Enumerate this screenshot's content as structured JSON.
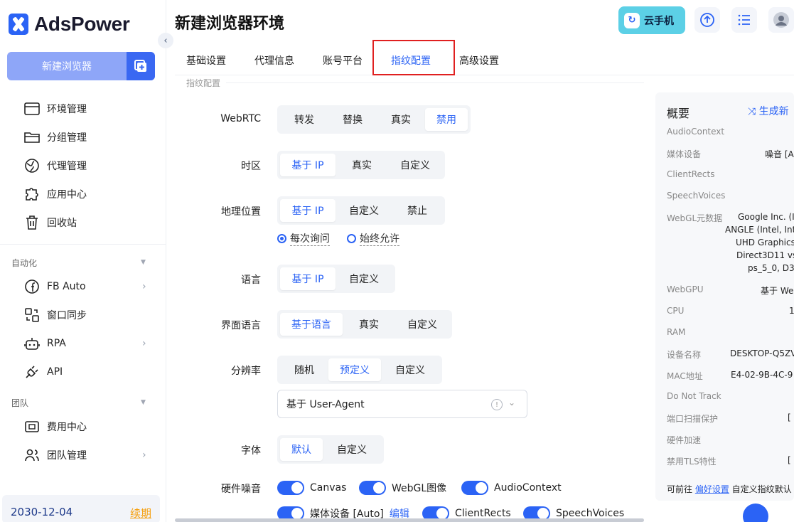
{
  "app": {
    "logo_text": "AdsPower",
    "brand_color": "#2b63f5"
  },
  "sidebar": {
    "new_browser_label": "新建浏览器",
    "items": [
      {
        "label": "环境管理",
        "icon": "browser-window-icon"
      },
      {
        "label": "分组管理",
        "icon": "folder-icon"
      },
      {
        "label": "代理管理",
        "icon": "globe-icon"
      },
      {
        "label": "应用中心",
        "icon": "puzzle-icon"
      },
      {
        "label": "回收站",
        "icon": "trash-icon"
      }
    ],
    "automation_title": "自动化",
    "automation_items": [
      {
        "label": "FB Auto",
        "icon": "facebook-icon"
      },
      {
        "label": "窗口同步",
        "icon": "sync-windows-icon"
      },
      {
        "label": "RPA",
        "icon": "robot-icon"
      },
      {
        "label": "API",
        "icon": "plug-icon"
      }
    ],
    "team_title": "团队",
    "team_items": [
      {
        "label": "费用中心",
        "icon": "wallet-icon"
      },
      {
        "label": "团队管理",
        "icon": "users-icon"
      }
    ],
    "expire_date": "2030-12-04",
    "renew_label": "续期"
  },
  "header": {
    "title": "新建浏览器环境",
    "cloud_phone_label": "云手机"
  },
  "tabs": [
    "基础设置",
    "代理信息",
    "账号平台",
    "指纹配置",
    "高级设置"
  ],
  "active_tab": "指纹配置",
  "section_label": "指纹配置",
  "form": {
    "webrtc": {
      "label": "WebRTC",
      "options": [
        "转发",
        "替换",
        "真实",
        "禁用"
      ],
      "selected": "禁用"
    },
    "timezone": {
      "label": "时区",
      "options": [
        "基于 IP",
        "真实",
        "自定义"
      ],
      "selected": "基于 IP"
    },
    "geo": {
      "label": "地理位置",
      "options": [
        "基于 IP",
        "自定义",
        "禁止"
      ],
      "selected": "基于 IP",
      "radio": [
        "每次询问",
        "始终允许"
      ],
      "radio_selected": "每次询问"
    },
    "language": {
      "label": "语言",
      "options": [
        "基于 IP",
        "自定义"
      ],
      "selected": "基于 IP"
    },
    "ui_language": {
      "label": "界面语言",
      "options": [
        "基于语言",
        "真实",
        "自定义"
      ],
      "selected": "基于语言"
    },
    "resolution": {
      "label": "分辨率",
      "options": [
        "随机",
        "预定义",
        "自定义"
      ],
      "selected": "预定义",
      "select_value": "基于 User-Agent"
    },
    "font": {
      "label": "字体",
      "options": [
        "默认",
        "自定义"
      ],
      "selected": "默认"
    },
    "noise": {
      "label": "硬件噪音",
      "toggles": [
        "Canvas",
        "WebGL图像",
        "AudioContext",
        "媒体设备 [Auto]",
        "ClientRects",
        "SpeechVoices"
      ],
      "edit_label": "编辑"
    }
  },
  "overview": {
    "title": "概要",
    "generate_label": "生成新",
    "rows": [
      {
        "key": "AudioContext",
        "value": ""
      },
      {
        "key": "媒体设备",
        "value": "噪音 [A"
      },
      {
        "key": "ClientRects",
        "value": ""
      },
      {
        "key": "SpeechVoices",
        "value": ""
      },
      {
        "key": "WebGL元数据",
        "value": "Google Inc. (I"
      },
      {
        "key": "",
        "value": "ANGLE (Intel, Int"
      },
      {
        "key": "",
        "value": "UHD Graphics"
      },
      {
        "key": "",
        "value": "Direct3D11 vs"
      },
      {
        "key": "",
        "value": "ps_5_0, D3"
      },
      {
        "key": "WebGPU",
        "value": "基于 We"
      },
      {
        "key": "CPU",
        "value": "1"
      },
      {
        "key": "RAM",
        "value": ""
      },
      {
        "key": "设备名称",
        "value": "DESKTOP-Q5ZV"
      },
      {
        "key": "MAC地址",
        "value": "E4-02-9B-4C-9"
      },
      {
        "key": "Do Not Track",
        "value": ""
      },
      {
        "key": "端口扫描保护",
        "value": "["
      },
      {
        "key": "硬件加速",
        "value": ""
      },
      {
        "key": "禁用TLS特性",
        "value": "["
      }
    ],
    "footer_prefix": "可前往 ",
    "footer_link": "偏好设置",
    "footer_suffix": " 自定义指纹默认"
  }
}
